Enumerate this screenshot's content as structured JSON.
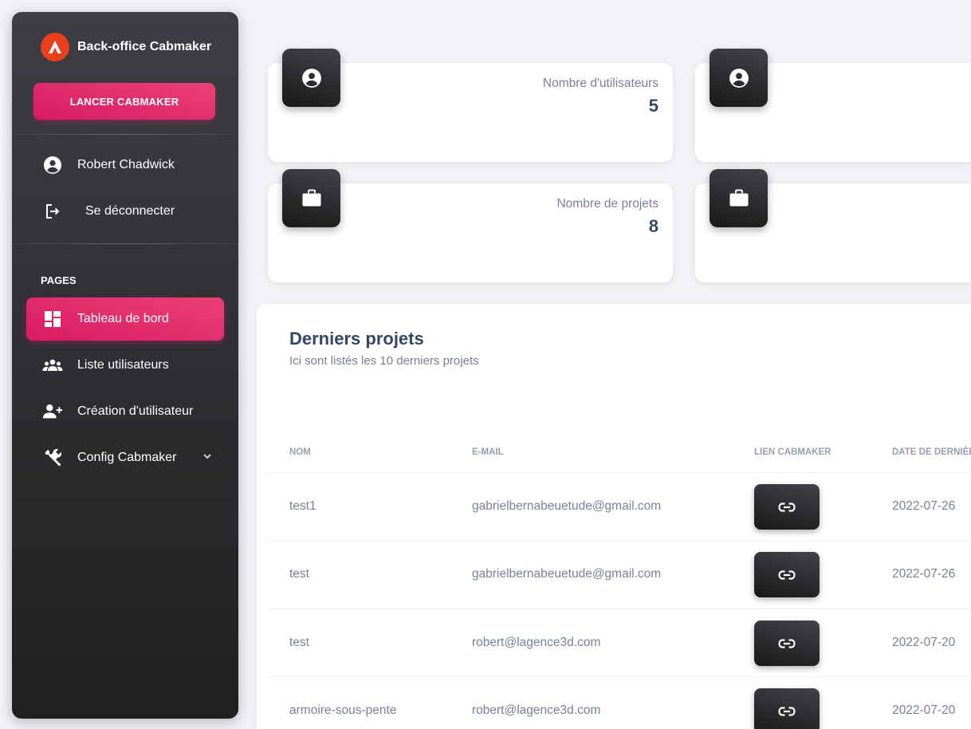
{
  "sidebar": {
    "brand": "Back-office Cabmaker",
    "launch_button": "LANCER CABMAKER",
    "user_name": "Robert Chadwick",
    "logout": "Se déconnecter",
    "section_title": "PAGES",
    "items": [
      {
        "label": "Tableau de bord",
        "icon": "dashboard-icon",
        "active": true
      },
      {
        "label": "Liste utilisateurs",
        "icon": "group-icon"
      },
      {
        "label": "Création d'utilisateur",
        "icon": "person-add-icon"
      },
      {
        "label": "Config Cabmaker",
        "icon": "wrench-icon"
      }
    ]
  },
  "stats": [
    {
      "label": "Nombre d'utilisateurs",
      "value": "5",
      "icon": "person-icon"
    },
    {
      "label": "",
      "value": "",
      "icon": "person-icon"
    },
    {
      "label": "Nombre de projets",
      "value": "8",
      "icon": "briefcase-icon"
    },
    {
      "label": "",
      "value": "",
      "icon": "briefcase-icon"
    }
  ],
  "projects": {
    "title": "Derniers projets",
    "subtitle": "Ici sont listés les 10 derniers projets",
    "columns": [
      "NOM",
      "E-MAIL",
      "LIEN CABMAKER",
      "DATE DE DERNIÈRE"
    ],
    "rows": [
      {
        "name": "test1",
        "email": "gabrielbernabeuetude@gmail.com",
        "date": "2022-07-26"
      },
      {
        "name": "test",
        "email": "gabrielbernabeuetude@gmail.com",
        "date": "2022-07-26"
      },
      {
        "name": "test",
        "email": "robert@lagence3d.com",
        "date": "2022-07-20"
      },
      {
        "name": "armoire-sous-pente",
        "email": "robert@lagence3d.com",
        "date": "2022-07-20"
      }
    ]
  },
  "colors": {
    "accent": "#e91e63",
    "dark": "#191919",
    "brand": "#e8401c",
    "background": "#f0f2f5"
  }
}
